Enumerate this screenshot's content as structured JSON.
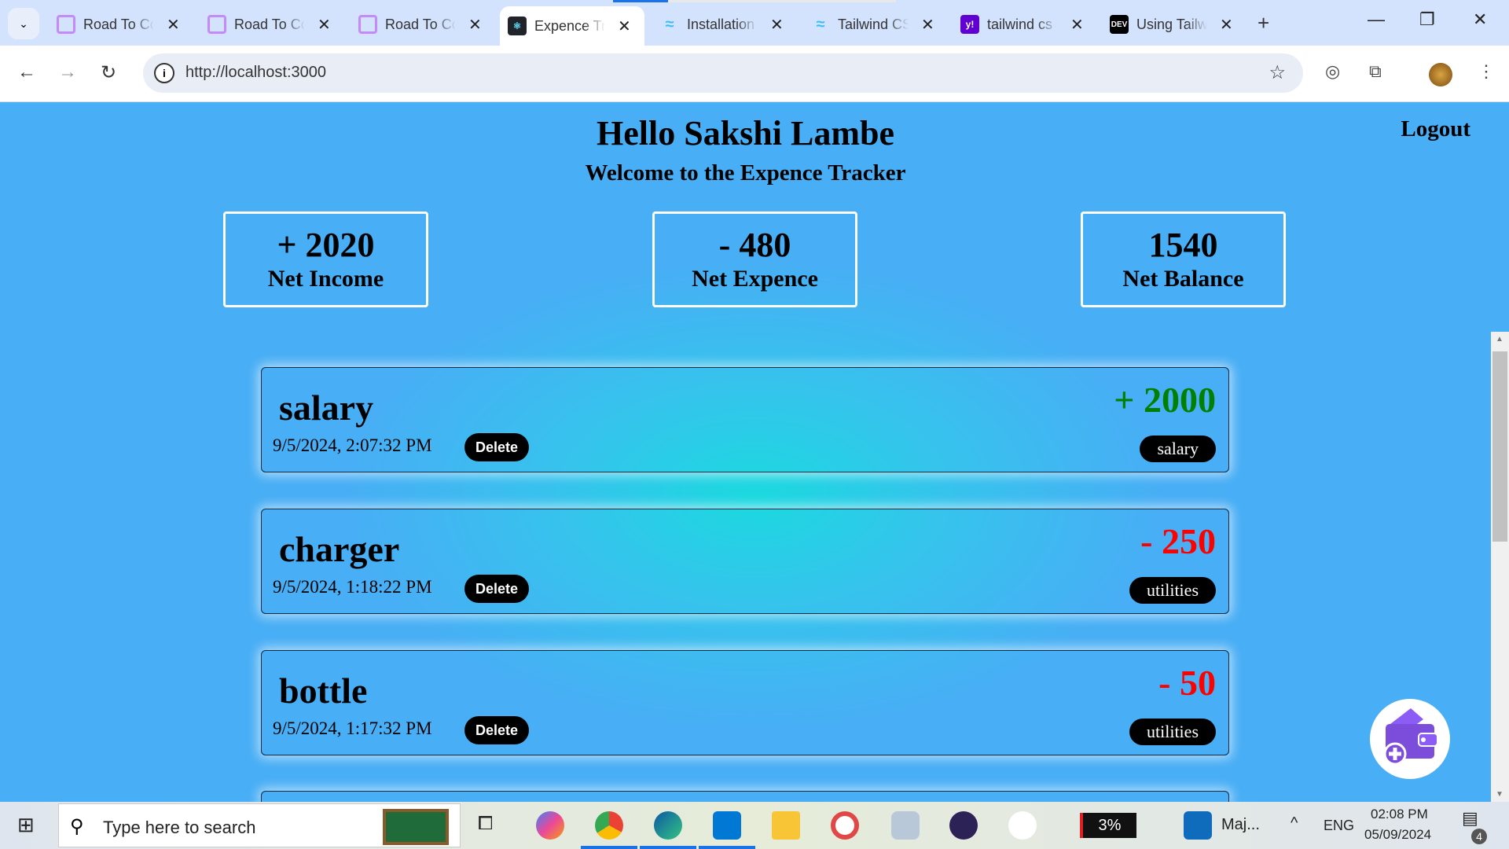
{
  "browser": {
    "tabs": [
      {
        "label": "Road To Co",
        "icon": "hexagon-icon",
        "active": false
      },
      {
        "label": "Road To Co",
        "icon": "hexagon-icon",
        "active": false
      },
      {
        "label": "Road To Co",
        "icon": "hexagon-icon",
        "active": false
      },
      {
        "label": "Expence Tr",
        "icon": "react-icon",
        "active": true
      },
      {
        "label": "Installation",
        "icon": "tailwind-icon",
        "active": false
      },
      {
        "label": "Tailwind CS",
        "icon": "tailwind-icon",
        "active": false
      },
      {
        "label": "tailwind cs",
        "icon": "yahoo-icon",
        "active": false
      },
      {
        "label": "Using Tailw",
        "icon": "dev-icon",
        "active": false
      }
    ],
    "url": "http://localhost:3000"
  },
  "app": {
    "greeting": "Hello Sakshi Lambe",
    "welcome": "Welcome to the Expence Tracker",
    "logout": "Logout",
    "summary": [
      {
        "value": "+ 2020",
        "label": "Net Income"
      },
      {
        "value": "- 480",
        "label": "Net Expence"
      },
      {
        "value": "1540",
        "label": "Net Balance"
      }
    ],
    "transactions": [
      {
        "title": "salary",
        "date": "9/5/2024, 2:07:32 PM",
        "amount": "+ 2000",
        "category": "salary",
        "color": "#008000"
      },
      {
        "title": "charger",
        "date": "9/5/2024, 1:18:22 PM",
        "amount": "- 250",
        "category": "utilities",
        "color": "#ff0000"
      },
      {
        "title": "bottle",
        "date": "9/5/2024, 1:17:32 PM",
        "amount": "- 50",
        "category": "utilities",
        "color": "#ff0000"
      }
    ],
    "delete_label": "Delete"
  },
  "taskbar": {
    "search_placeholder": "Type here to search",
    "battery": "3%",
    "outlook_label": "Maj...",
    "lang": "ENG",
    "time": "02:08 PM",
    "date": "05/09/2024",
    "notifications": "4"
  }
}
